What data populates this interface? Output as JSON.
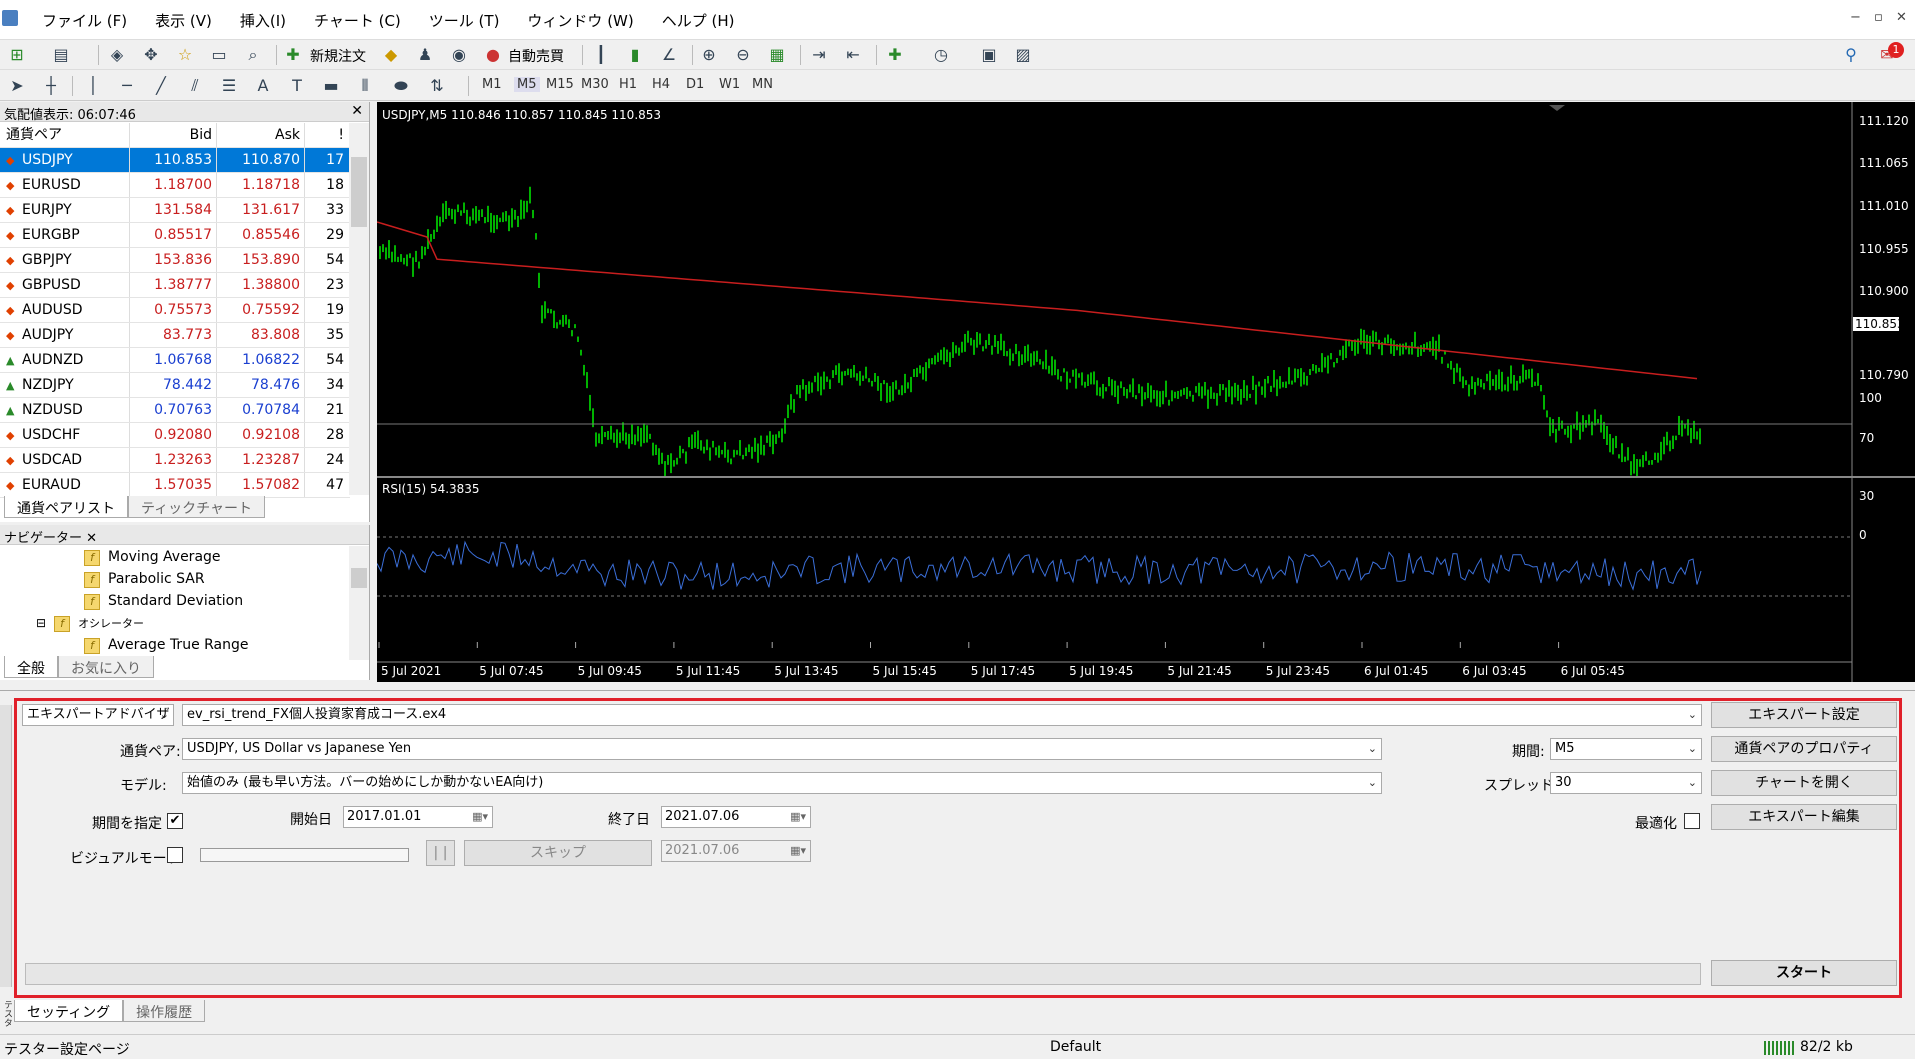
{
  "menu": {
    "items": [
      "ファイル (F)",
      "表示 (V)",
      "挿入(I)",
      "チャート (C)",
      "ツール (T)",
      "ウィンドウ (W)",
      "ヘルプ (H)"
    ],
    "window_buttons": [
      "−",
      "▫",
      "✕"
    ]
  },
  "toolbar": {
    "new_order": "新規注文",
    "auto_trade": "自動売買",
    "timeframes": [
      "M1",
      "M5",
      "M15",
      "M30",
      "H1",
      "H4",
      "D1",
      "W1",
      "MN"
    ],
    "notification_count": "1"
  },
  "market_watch": {
    "title": "気配値表示: 06:07:46",
    "columns": [
      "通貨ペア",
      "Bid",
      "Ask",
      "!"
    ],
    "rows": [
      {
        "symbol": "USDJPY",
        "bid": "110.853",
        "ask": "110.870",
        "spread": "17",
        "dir": "down",
        "selected": true
      },
      {
        "symbol": "EURUSD",
        "bid": "1.18700",
        "ask": "1.18718",
        "spread": "18",
        "dir": "down"
      },
      {
        "symbol": "EURJPY",
        "bid": "131.584",
        "ask": "131.617",
        "spread": "33",
        "dir": "down"
      },
      {
        "symbol": "EURGBP",
        "bid": "0.85517",
        "ask": "0.85546",
        "spread": "29",
        "dir": "down"
      },
      {
        "symbol": "GBPJPY",
        "bid": "153.836",
        "ask": "153.890",
        "spread": "54",
        "dir": "down"
      },
      {
        "symbol": "GBPUSD",
        "bid": "1.38777",
        "ask": "1.38800",
        "spread": "23",
        "dir": "down"
      },
      {
        "symbol": "AUDUSD",
        "bid": "0.75573",
        "ask": "0.75592",
        "spread": "19",
        "dir": "down"
      },
      {
        "symbol": "AUDJPY",
        "bid": "83.773",
        "ask": "83.808",
        "spread": "35",
        "dir": "down"
      },
      {
        "symbol": "AUDNZD",
        "bid": "1.06768",
        "ask": "1.06822",
        "spread": "54",
        "dir": "up"
      },
      {
        "symbol": "NZDJPY",
        "bid": "78.442",
        "ask": "78.476",
        "spread": "34",
        "dir": "up"
      },
      {
        "symbol": "NZDUSD",
        "bid": "0.70763",
        "ask": "0.70784",
        "spread": "21",
        "dir": "up"
      },
      {
        "symbol": "USDCHF",
        "bid": "0.92080",
        "ask": "0.92108",
        "spread": "28",
        "dir": "down"
      },
      {
        "symbol": "USDCAD",
        "bid": "1.23263",
        "ask": "1.23287",
        "spread": "24",
        "dir": "down"
      },
      {
        "symbol": "EURAUD",
        "bid": "1.57035",
        "ask": "1.57082",
        "spread": "47",
        "dir": "down"
      }
    ],
    "tabs": [
      "通貨ペアリスト",
      "ティックチャート"
    ]
  },
  "navigator": {
    "title": "ナビゲーター",
    "items": [
      "Moving Average",
      "Parabolic SAR",
      "Standard Deviation",
      "オシレーター",
      "Average True Range"
    ],
    "tabs": [
      "全般",
      "お気に入り"
    ]
  },
  "chart": {
    "header": "USDJPY,M5  110.846 110.857 110.845 110.853",
    "rsi_header": "RSI(15) 54.3835",
    "price_labels": [
      "111.120",
      "111.065",
      "111.010",
      "110.955",
      "110.900",
      "110.853",
      "110.790"
    ],
    "current_price": "110.853",
    "rsi_labels": [
      "100",
      "70",
      "30",
      "0"
    ],
    "time_labels": [
      "5 Jul 2021",
      "5 Jul 07:45",
      "5 Jul 09:45",
      "5 Jul 11:45",
      "5 Jul 13:45",
      "5 Jul 15:45",
      "5 Jul 17:45",
      "5 Jul 19:45",
      "5 Jul 21:45",
      "5 Jul 23:45",
      "6 Jul 01:45",
      "6 Jul 03:45",
      "6 Jul 05:45"
    ],
    "colors": {
      "bars": "#00e000",
      "ma": "#c81e1e",
      "rsi": "#3b6fd9",
      "background": "#000000"
    }
  },
  "tester": {
    "type_select": "エキスパートアドバイザ",
    "expert_file": "ev_rsi_trend_FX個人投資家育成コース.ex4",
    "symbol_label": "通貨ペア:",
    "symbol_value": "USDJPY, US Dollar vs Japanese Yen",
    "model_label": "モデル:",
    "model_value": "始値のみ (最も早い方法。バーの始めにしか動かないEA向け)",
    "period_label": "期間:",
    "period_value": "M5",
    "spread_label": "スプレッド:",
    "spread_value": "30",
    "use_date_label": "期間を指定",
    "use_date_checked": "✔",
    "start_label": "開始日",
    "start_value": "2017.01.01",
    "end_label": "終了日",
    "end_value": "2021.07.06",
    "visual_label": "ビジュアルモード",
    "pause_label": "| |",
    "skip_label": "スキップ",
    "skip_date": "2021.07.06",
    "optimize_label": "最適化",
    "btn_expert_settings": "エキスパート設定",
    "btn_symbol_props": "通貨ペアのプロパティ",
    "btn_open_chart": "チャートを開く",
    "btn_edit_expert": "エキスパート編集",
    "btn_start": "スタート",
    "tabs": [
      "セッティング",
      "操作履歴"
    ],
    "side_label": "テスター"
  },
  "status": {
    "left": "テスター設定ページ",
    "profile": "Default",
    "traffic": "82/2 kb"
  }
}
